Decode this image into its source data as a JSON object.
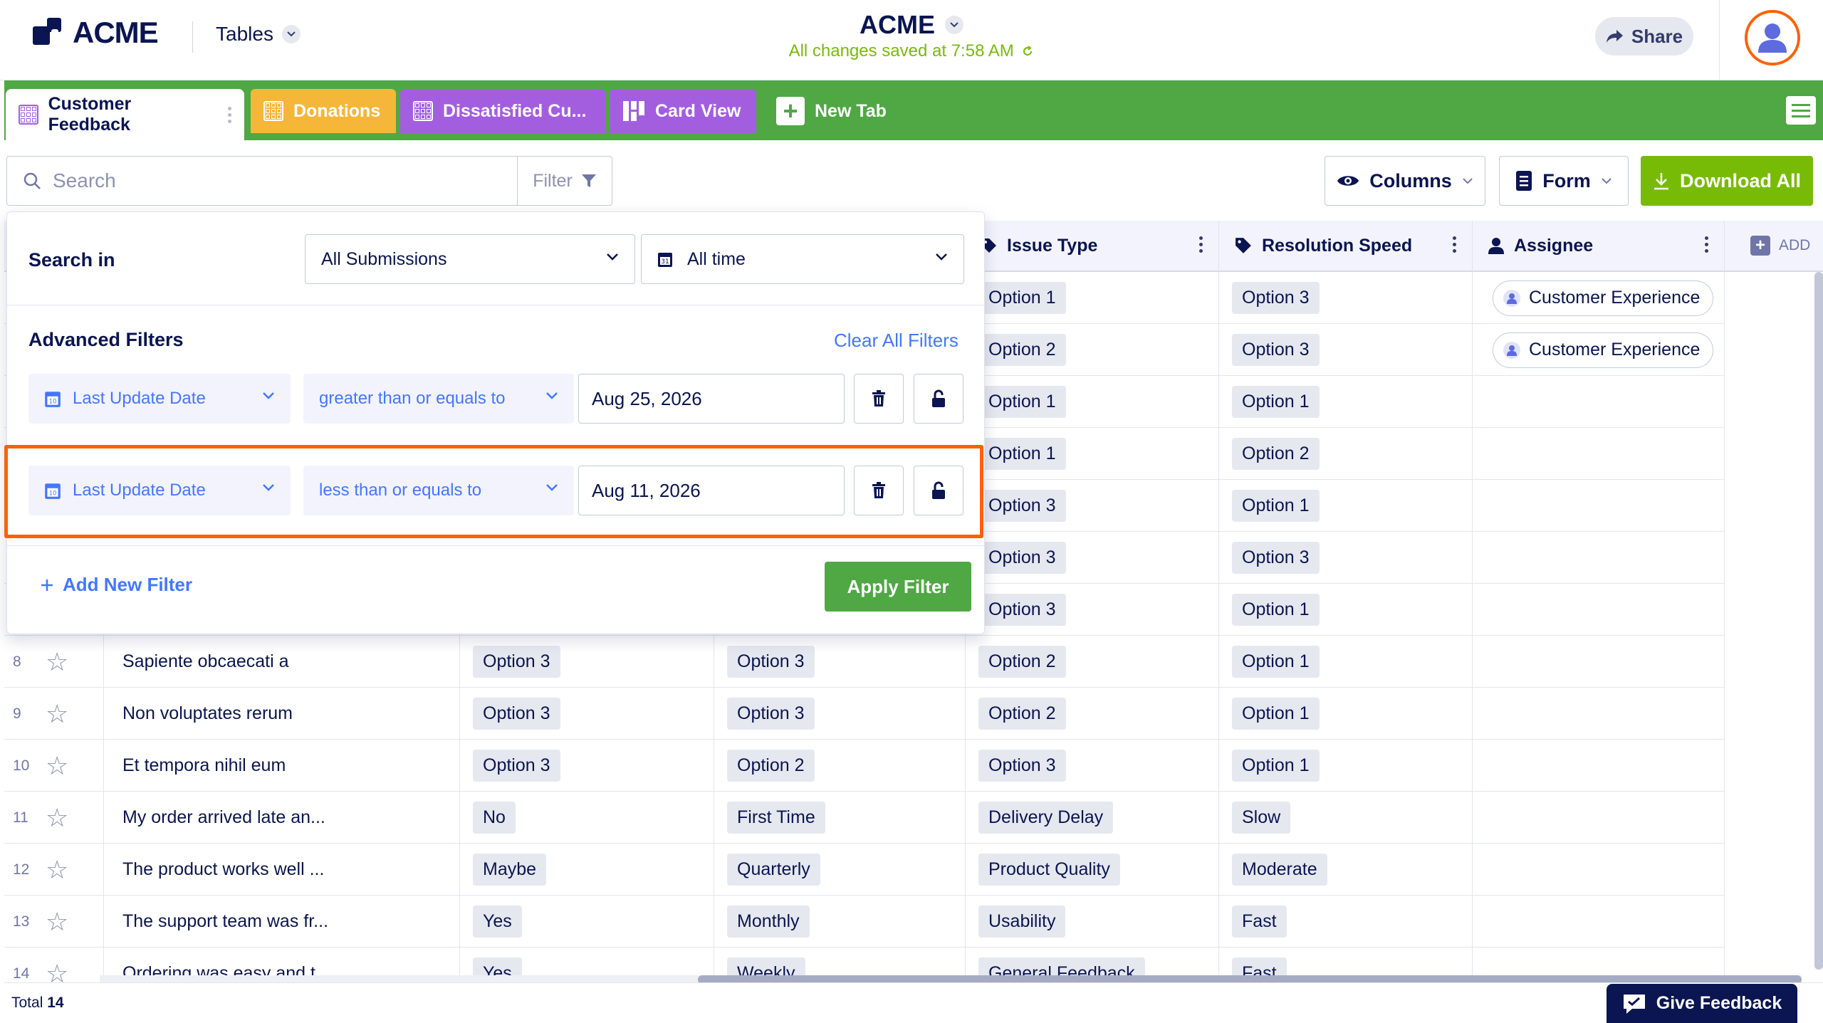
{
  "header": {
    "logo_text": "ACME",
    "tables_label": "Tables",
    "app_title": "ACME",
    "save_status": "All changes saved at 7:58 AM",
    "share_label": "Share"
  },
  "tabs": [
    {
      "label": "Customer Feedback",
      "color": "#ffffff"
    },
    {
      "label": "Donations",
      "color": "#f6b63a"
    },
    {
      "label": "Dissatisfied Cu...",
      "color": "#a35ee0"
    },
    {
      "label": "Card View",
      "color": "#a35ee0"
    },
    {
      "label": "New Tab",
      "color": "#4fa843"
    }
  ],
  "toolbar": {
    "search_placeholder": "Search",
    "filter_label": "Filter",
    "columns_label": "Columns",
    "form_label": "Form",
    "download_label": "Download All"
  },
  "columns": {
    "issue_type": "Issue Type",
    "resolution_speed": "Resolution Speed",
    "assignee": "Assignee",
    "add": "ADD"
  },
  "rows": [
    {
      "num": "1",
      "text": "",
      "c1": "",
      "c2": "",
      "c3": "Option 1",
      "c4": "Option 3",
      "assignee": "Customer Experience"
    },
    {
      "num": "2",
      "text": "",
      "c1": "",
      "c2": "",
      "c3": "Option 2",
      "c4": "Option 3",
      "assignee": "Customer Experience"
    },
    {
      "num": "3",
      "text": "",
      "c1": "",
      "c2": "",
      "c3": "Option 1",
      "c4": "Option 1",
      "assignee": ""
    },
    {
      "num": "4",
      "text": "",
      "c1": "",
      "c2": "",
      "c3": "Option 1",
      "c4": "Option 2",
      "assignee": ""
    },
    {
      "num": "5",
      "text": "",
      "c1": "",
      "c2": "",
      "c3": "Option 3",
      "c4": "Option 1",
      "assignee": ""
    },
    {
      "num": "6",
      "text": "",
      "c1": "",
      "c2": "",
      "c3": "Option 3",
      "c4": "Option 3",
      "assignee": ""
    },
    {
      "num": "7",
      "text": "",
      "c1": "",
      "c2": "",
      "c3": "Option 3",
      "c4": "Option 1",
      "assignee": ""
    },
    {
      "num": "8",
      "text": "Sapiente obcaecati a",
      "c1": "Option 3",
      "c2": "Option 3",
      "c3": "Option 2",
      "c4": "Option 1",
      "assignee": ""
    },
    {
      "num": "9",
      "text": "Non voluptates rerum",
      "c1": "Option 3",
      "c2": "Option 3",
      "c3": "Option 2",
      "c4": "Option 1",
      "assignee": ""
    },
    {
      "num": "10",
      "text": "Et tempora nihil eum",
      "c1": "Option 3",
      "c2": "Option 2",
      "c3": "Option 3",
      "c4": "Option 1",
      "assignee": ""
    },
    {
      "num": "11",
      "text": "My order arrived late an...",
      "c1": "No",
      "c2": "First Time",
      "c3": "Delivery Delay",
      "c4": "Slow",
      "assignee": ""
    },
    {
      "num": "12",
      "text": "The product works well ...",
      "c1": "Maybe",
      "c2": "Quarterly",
      "c3": "Product Quality",
      "c4": "Moderate",
      "assignee": ""
    },
    {
      "num": "13",
      "text": "The support team was fr...",
      "c1": "Yes",
      "c2": "Monthly",
      "c3": "Usability",
      "c4": "Fast",
      "assignee": ""
    },
    {
      "num": "14",
      "text": "Ordering was easy and t...",
      "c1": "Yes",
      "c2": "Weekly",
      "c3": "General Feedback",
      "c4": "Fast",
      "assignee": ""
    }
  ],
  "footer": {
    "total_label": "Total",
    "total_value": "14",
    "feedback_label": "Give Feedback"
  },
  "filter_panel": {
    "search_in_label": "Search in",
    "scope_value": "All Submissions",
    "time_value": "All time",
    "advanced_label": "Advanced Filters",
    "clear_label": "Clear All Filters",
    "filters": [
      {
        "field": "Last Update Date",
        "operator": "greater than or equals to",
        "value": "Aug 25, 2026"
      },
      {
        "field": "Last Update Date",
        "operator": "less than or equals to",
        "value": "Aug 11, 2026"
      }
    ],
    "add_filter_label": "Add New Filter",
    "apply_label": "Apply Filter"
  },
  "colors": {
    "tabbar": "#4fa843",
    "accent_blue": "#4277ff",
    "highlight": "#ff6100",
    "navy": "#0a1551"
  }
}
